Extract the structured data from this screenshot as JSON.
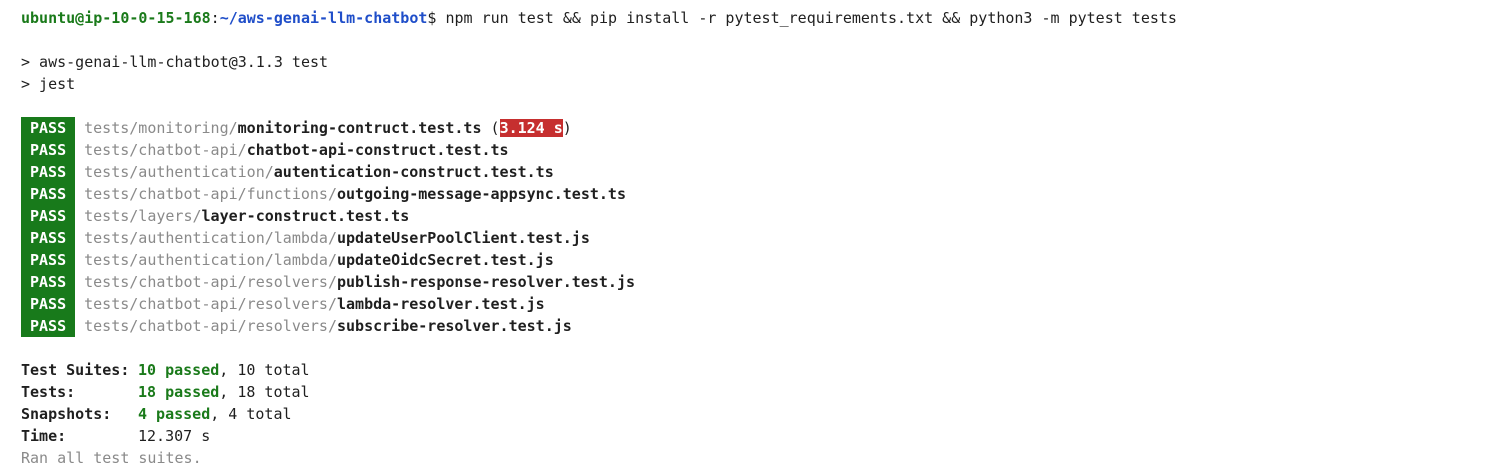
{
  "prompt": {
    "user_host": "ubuntu@ip-10-0-15-168",
    "colon": ":",
    "path": "~/aws-genai-llm-chatbot",
    "symbol": "$",
    "command": " npm run test && pip install -r pytest_requirements.txt && python3 -m pytest tests"
  },
  "script_lines": [
    "> aws-genai-llm-chatbot@3.1.3 test",
    "> jest"
  ],
  "badge_label": "PASS",
  "results": [
    {
      "dir": "tests/monitoring/",
      "file": "monitoring-contruct.test.ts",
      "time": "3.124 s"
    },
    {
      "dir": "tests/chatbot-api/",
      "file": "chatbot-api-construct.test.ts"
    },
    {
      "dir": "tests/authentication/",
      "file": "autentication-construct.test.ts"
    },
    {
      "dir": "tests/chatbot-api/functions/",
      "file": "outgoing-message-appsync.test.ts"
    },
    {
      "dir": "tests/layers/",
      "file": "layer-construct.test.ts"
    },
    {
      "dir": "tests/authentication/lambda/",
      "file": "updateUserPoolClient.test.js"
    },
    {
      "dir": "tests/authentication/lambda/",
      "file": "updateOidcSecret.test.js"
    },
    {
      "dir": "tests/chatbot-api/resolvers/",
      "file": "publish-response-resolver.test.js"
    },
    {
      "dir": "tests/chatbot-api/resolvers/",
      "file": "lambda-resolver.test.js"
    },
    {
      "dir": "tests/chatbot-api/resolvers/",
      "file": "subscribe-resolver.test.js"
    }
  ],
  "summary": {
    "suites": {
      "label": "Test Suites:",
      "passed": "10 passed",
      "total": ", 10 total"
    },
    "tests": {
      "label": "Tests:",
      "passed": "18 passed",
      "total": ", 18 total"
    },
    "snapshots": {
      "label": "Snapshots:",
      "passed": "4 passed",
      "total": ", 4 total"
    },
    "time": {
      "label": "Time:",
      "value": "12.307 s"
    },
    "footer": "Ran all test suites."
  },
  "colors": {
    "pass_badge": "#187a1b",
    "slow_time": "#c62f2f",
    "prompt_user": "#1a7a1a",
    "prompt_path": "#1f4ec9"
  }
}
